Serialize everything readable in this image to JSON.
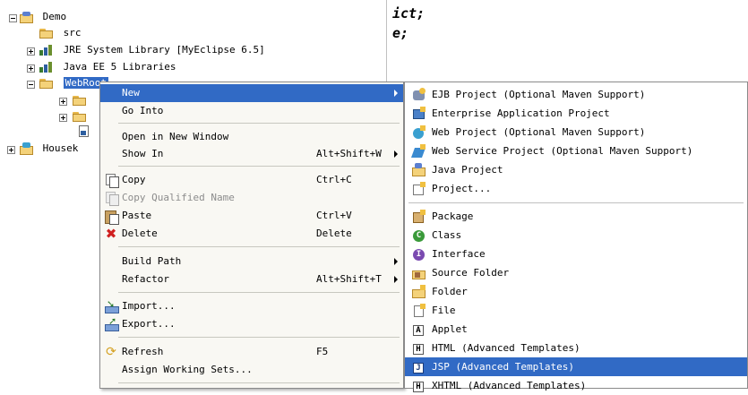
{
  "tree": {
    "project": "Demo",
    "items": [
      {
        "label": "src"
      },
      {
        "label": "JRE System Library [MyEclipse 6.5]"
      },
      {
        "label": "Java EE 5 Libraries"
      },
      {
        "label": "WebRoot"
      }
    ],
    "other_project": "Housek"
  },
  "editor": {
    "line1": "ict;",
    "line2": "e;"
  },
  "context_menu": {
    "new": "New",
    "go_into": "Go Into",
    "open_new_window": "Open in New Window",
    "show_in": "Show In",
    "show_in_accel": "Alt+Shift+W",
    "copy": "Copy",
    "copy_accel": "Ctrl+C",
    "copy_qualified": "Copy Qualified Name",
    "paste": "Paste",
    "paste_accel": "Ctrl+V",
    "delete": "Delete",
    "delete_accel": "Delete",
    "build_path": "Build Path",
    "refactor": "Refactor",
    "refactor_accel": "Alt+Shift+T",
    "import": "Import...",
    "export": "Export...",
    "refresh": "Refresh",
    "refresh_accel": "F5",
    "assign_working_sets": "Assign Working Sets..."
  },
  "submenu": {
    "items": [
      "EJB Project (Optional Maven Support)",
      "Enterprise Application Project",
      "Web Project (Optional Maven Support)",
      "Web Service Project (Optional Maven Support)",
      "Java Project",
      "Project...",
      "Package",
      "Class",
      "Interface",
      "Source Folder",
      "Folder",
      "File",
      "Applet",
      "HTML (Advanced Templates)",
      "JSP (Advanced Templates)",
      "XHTML (Advanced Templates)"
    ]
  },
  "colors": {
    "selection": "#316ac5",
    "menu_bg": "#f9f8f3"
  }
}
